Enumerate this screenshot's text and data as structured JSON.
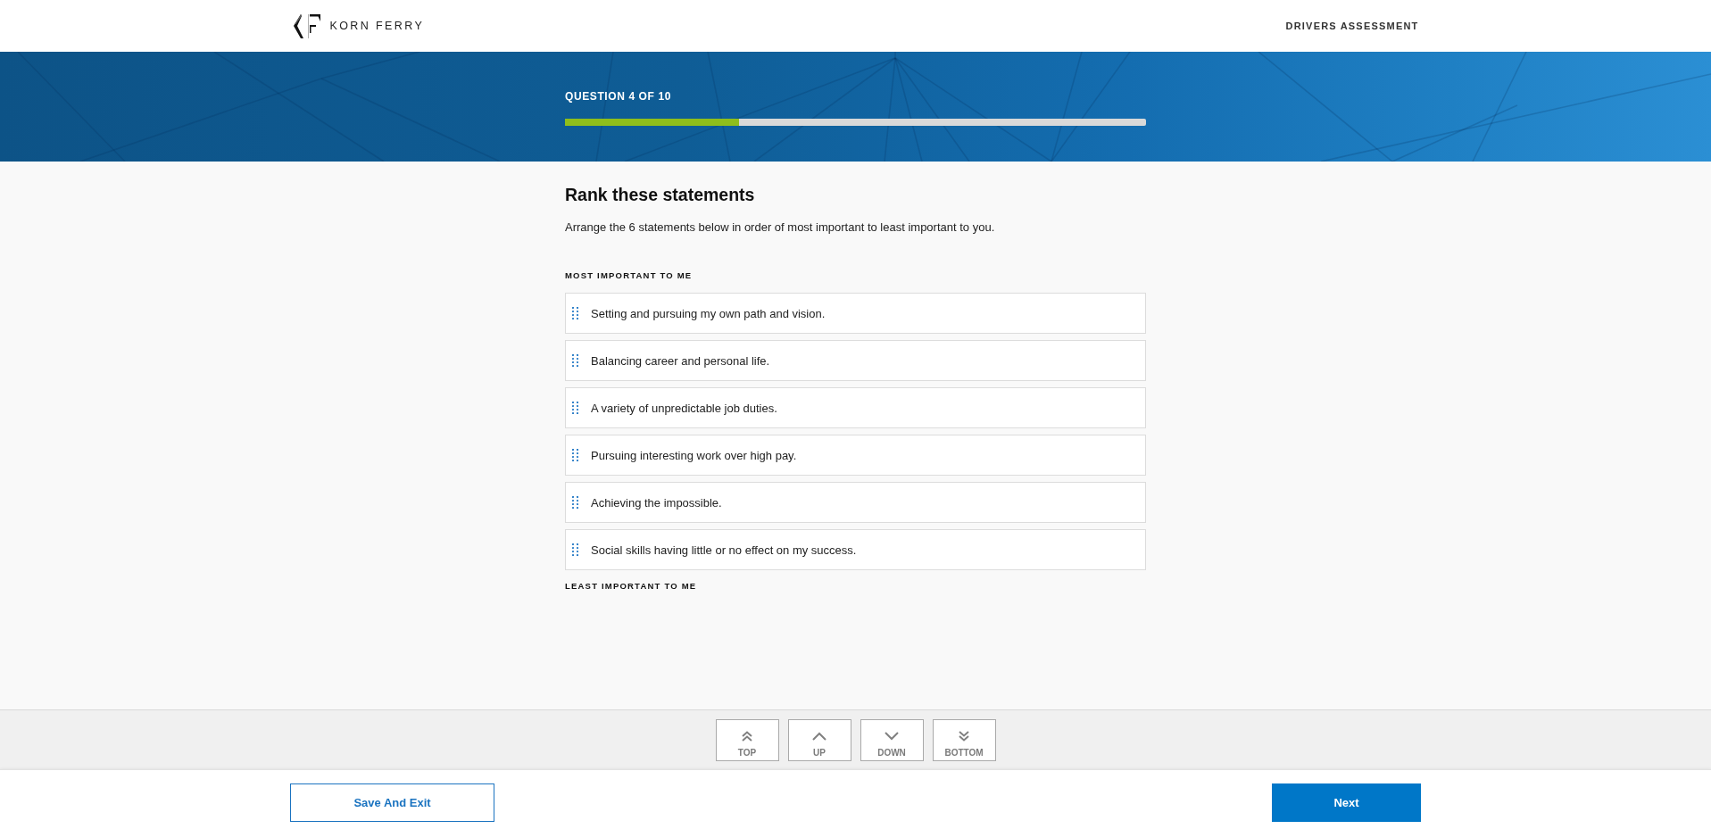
{
  "header": {
    "brand": "KORN FERRY",
    "title": "DRIVERS ASSESSMENT"
  },
  "progress": {
    "label": "QUESTION 4 OF 10",
    "level": 0.3
  },
  "question": {
    "title": "Rank these statements",
    "instructions": "Arrange the 6 statements below in order of most important to least important to you.",
    "top_label": "MOST IMPORTANT TO ME",
    "statements": [
      "Setting and pursuing my own path and vision.",
      "Balancing career and personal life.",
      "A variety of unpredictable job duties.",
      "Pursuing interesting work over high pay.",
      "Achieving the impossible.",
      "Social skills having little or no effect on my success."
    ],
    "bottom_label": "LEAST IMPORTANT TO ME"
  },
  "move_buttons": [
    {
      "kind": "top",
      "label": "TOP"
    },
    {
      "kind": "up",
      "label": "UP"
    },
    {
      "kind": "down",
      "label": "DOWN"
    },
    {
      "kind": "bottom",
      "label": "BOTTOM"
    }
  ],
  "footer": {
    "buttons": [
      {
        "kind": "secondary",
        "label": "Save And Exit"
      },
      {
        "kind": "primary",
        "label": "Next"
      }
    ]
  }
}
